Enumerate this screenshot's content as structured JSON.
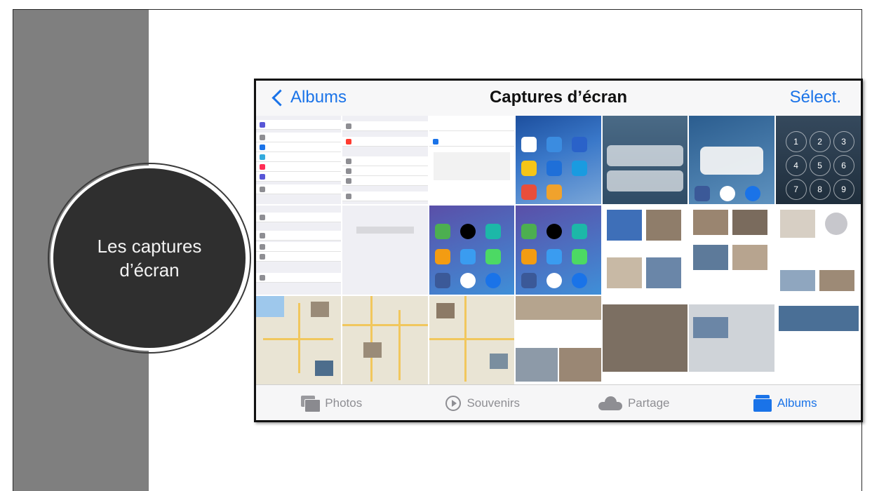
{
  "slide": {
    "title": "Les captures d’écran"
  },
  "navbar": {
    "back_label": "Albums",
    "title": "Captures d’écran",
    "select_label": "Sélect."
  },
  "tabbar": {
    "items": [
      {
        "label": "Photos",
        "icon": "photos-icon",
        "active": false
      },
      {
        "label": "Souvenirs",
        "icon": "memories-icon",
        "active": false
      },
      {
        "label": "Partage",
        "icon": "cloud-icon",
        "active": false
      },
      {
        "label": "Albums",
        "icon": "albums-icon",
        "active": true
      }
    ]
  },
  "colors": {
    "accent": "#1a73e8",
    "side_band": "#7f7f7f",
    "circle": "#2f2f2f"
  }
}
